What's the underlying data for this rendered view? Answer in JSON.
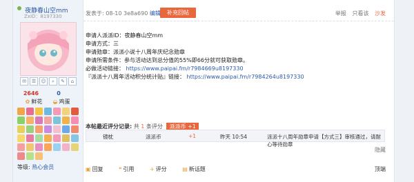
{
  "user": {
    "name": "夜静春山空mm",
    "uid": "ZxID：8197330",
    "stats": {
      "flowers": "2646",
      "eggs": "0",
      "flowers_label": "鲜花",
      "eggs_label": "鸡蛋"
    },
    "level_label": "等级:",
    "level_value": "热心会员"
  },
  "post": {
    "meta": "发表于: 08-10 3e8a690",
    "edit": "编辑",
    "add_button": "补充回帖",
    "actions": {
      "report": "举报",
      "quote": "只看该",
      "sofa": "沙发"
    },
    "lines": [
      "申请人派派ID：夜静春山空mm",
      "申请方式：三",
      "申请勋章：派派小说十八周年庆纪念勋章",
      "申请所需条件：参与活动达到总分值的55%即66分就可获取勋章。"
    ],
    "link1_label": "必做活动链接：",
    "link1": "https://www.paipai.fm/r7984669u8197330",
    "link2_label": "『派派十八周年活动积分统计贴』链接：",
    "link2": "https://www.paipai.fm/r7984264u8197330"
  },
  "rating": {
    "title": "本帖最近评分记录:",
    "count_prefix": "共",
    "count": "1",
    "count_suffix": "条评分",
    "coin": "派派币 +1",
    "row": {
      "user": "镜枕",
      "currency": "派派币",
      "amount": "+1",
      "time": "昨天 10:54",
      "reason": "派派十八周年勋章申请【方式三】审核通过，请耐心等待勋章"
    }
  },
  "hide_label": "隐藏",
  "footer": {
    "reply": "回复",
    "quote": "引用",
    "rate": "评分",
    "new_topic": "新话题",
    "top": "顶端"
  }
}
